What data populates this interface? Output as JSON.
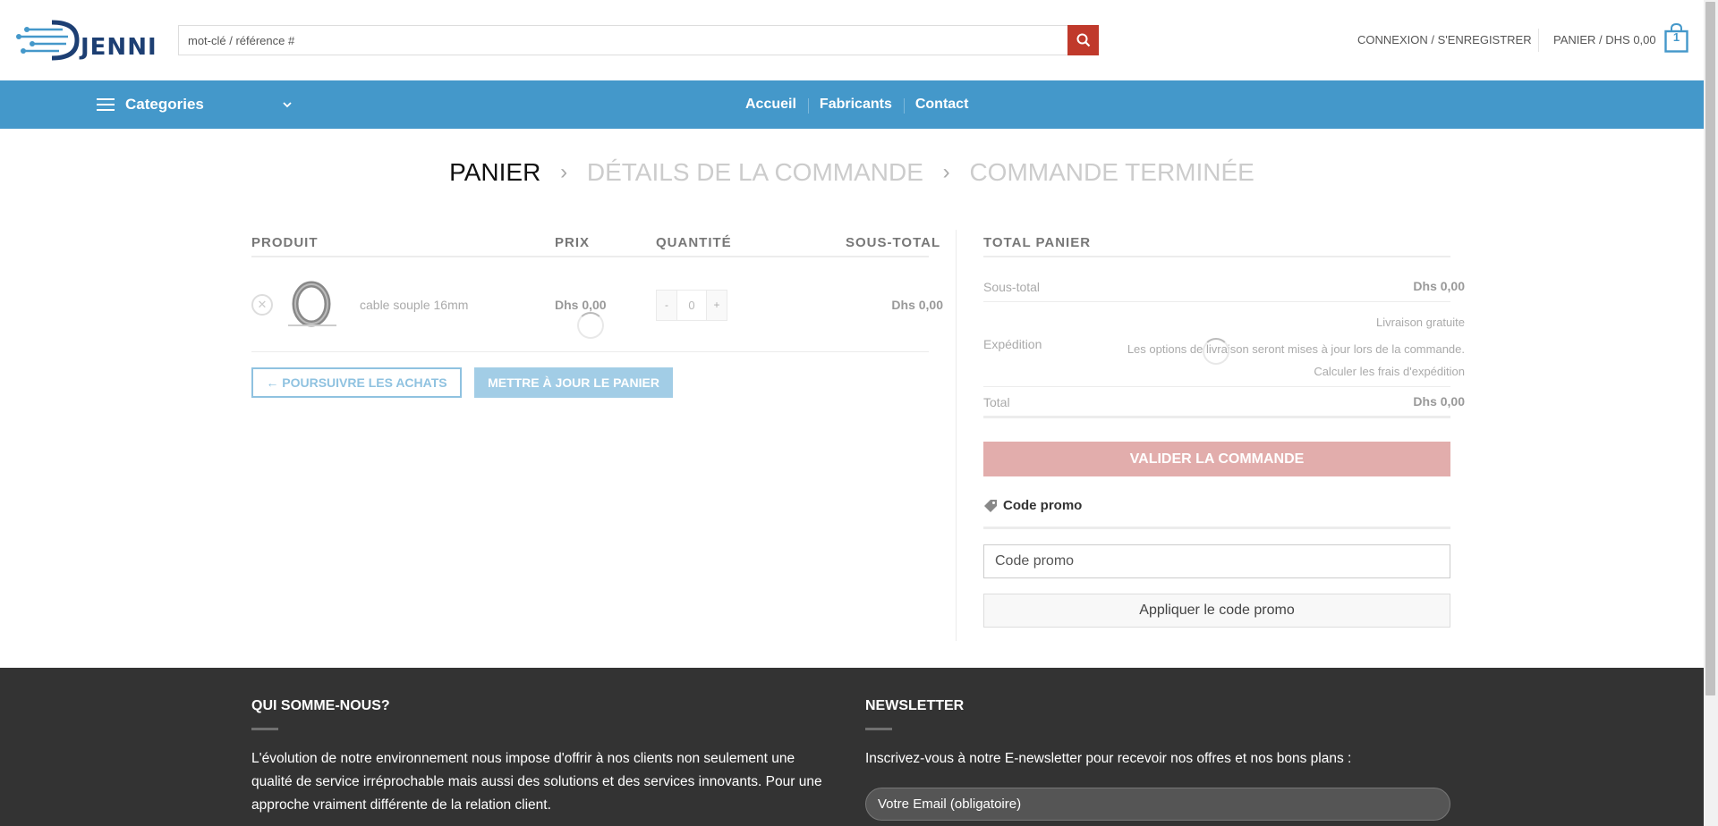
{
  "header": {
    "logo_text": "JENNI",
    "search_placeholder": "mot-clé / référence #",
    "login_label": "CONNEXION / S'ENREGISTRER",
    "cart_label": "PANIER / DHS 0,00",
    "cart_count": "1"
  },
  "nav": {
    "categories_label": "Categories",
    "items": [
      {
        "label": "Accueil"
      },
      {
        "label": "Fabricants"
      },
      {
        "label": "Contact"
      }
    ]
  },
  "steps": {
    "cart": "PANIER",
    "details": "DÉTAILS DE LA COMMANDE",
    "done": "COMMANDE TERMINÉE"
  },
  "cart": {
    "headers": {
      "product": "PRODUIT",
      "price": "PRIX",
      "quantity": "QUANTITÉ",
      "subtotal": "SOUS-TOTAL"
    },
    "items": [
      {
        "name": "cable souple 16mm",
        "price": "Dhs 0,00",
        "quantity": "0",
        "subtotal": "Dhs 0,00",
        "minus": "-",
        "plus": "+"
      }
    ],
    "continue_label": "← POURSUIVRE LES ACHATS",
    "update_label": "METTRE À JOUR LE PANIER"
  },
  "totals": {
    "title": "TOTAL PANIER",
    "subtotal_label": "Sous-total",
    "subtotal_value": "Dhs 0,00",
    "shipping_label": "Expédition",
    "shipping_free": "Livraison gratuite",
    "shipping_note": "Les options de livraison seront mises à jour lors de la commande.",
    "shipping_calc": "Calculer les frais d'expédition",
    "total_label": "Total",
    "total_value": "Dhs 0,00",
    "checkout_label": "VALIDER LA COMMANDE"
  },
  "promo": {
    "title": "Code promo",
    "input_placeholder": "Code promo",
    "apply_label": "Appliquer le code promo"
  },
  "footer": {
    "about_title": "QUI SOMME-NOUS?",
    "about_text_lines": [
      "L'évolution de notre environnement nous impose d'offrir à nos clients non seulement une",
      "qualité de service irréprochable mais aussi des solutions et des services innovants. Pour une",
      "approche vraiment différente de la relation client."
    ],
    "newsletter_title": "NEWSLETTER",
    "newsletter_text": "Inscrivez-vous à notre E-newsletter pour recevoir nos offres et nos bons plans :",
    "email_placeholder": "Votre Email (obligatoire)"
  },
  "colors": {
    "nav_blue": "#4498ca",
    "search_red": "#c0392b",
    "checkout_pink": "#e2adac",
    "footer_dark": "#333333",
    "logo_navy": "#1d3f73"
  },
  "icons": {
    "search": "search-icon",
    "menu": "hamburger-icon",
    "chevron": "chevron-down-icon",
    "cart": "shopping-bag-icon",
    "remove": "close-circle-icon",
    "tag": "tag-icon",
    "logo": "circuit-logo-icon"
  }
}
